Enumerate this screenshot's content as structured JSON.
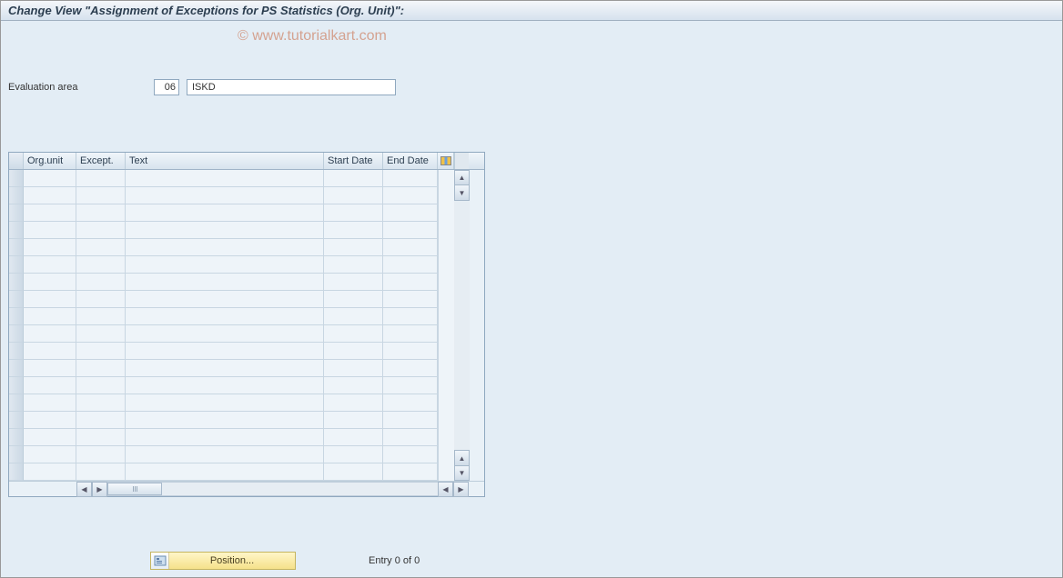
{
  "title": "Change View \"Assignment of Exceptions for PS Statistics (Org. Unit)\":",
  "watermark": "© www.tutorialkart.com",
  "form": {
    "evaluation_area_label": "Evaluation area",
    "evaluation_area_code": "06",
    "evaluation_area_text": "ISKD"
  },
  "table": {
    "columns": {
      "orgunit": "Org.unit",
      "except": "Except.",
      "text": "Text",
      "start": "Start Date",
      "end": "End Date"
    },
    "rows": 18
  },
  "footer": {
    "position_button": "Position...",
    "entry_text": "Entry 0 of 0"
  }
}
